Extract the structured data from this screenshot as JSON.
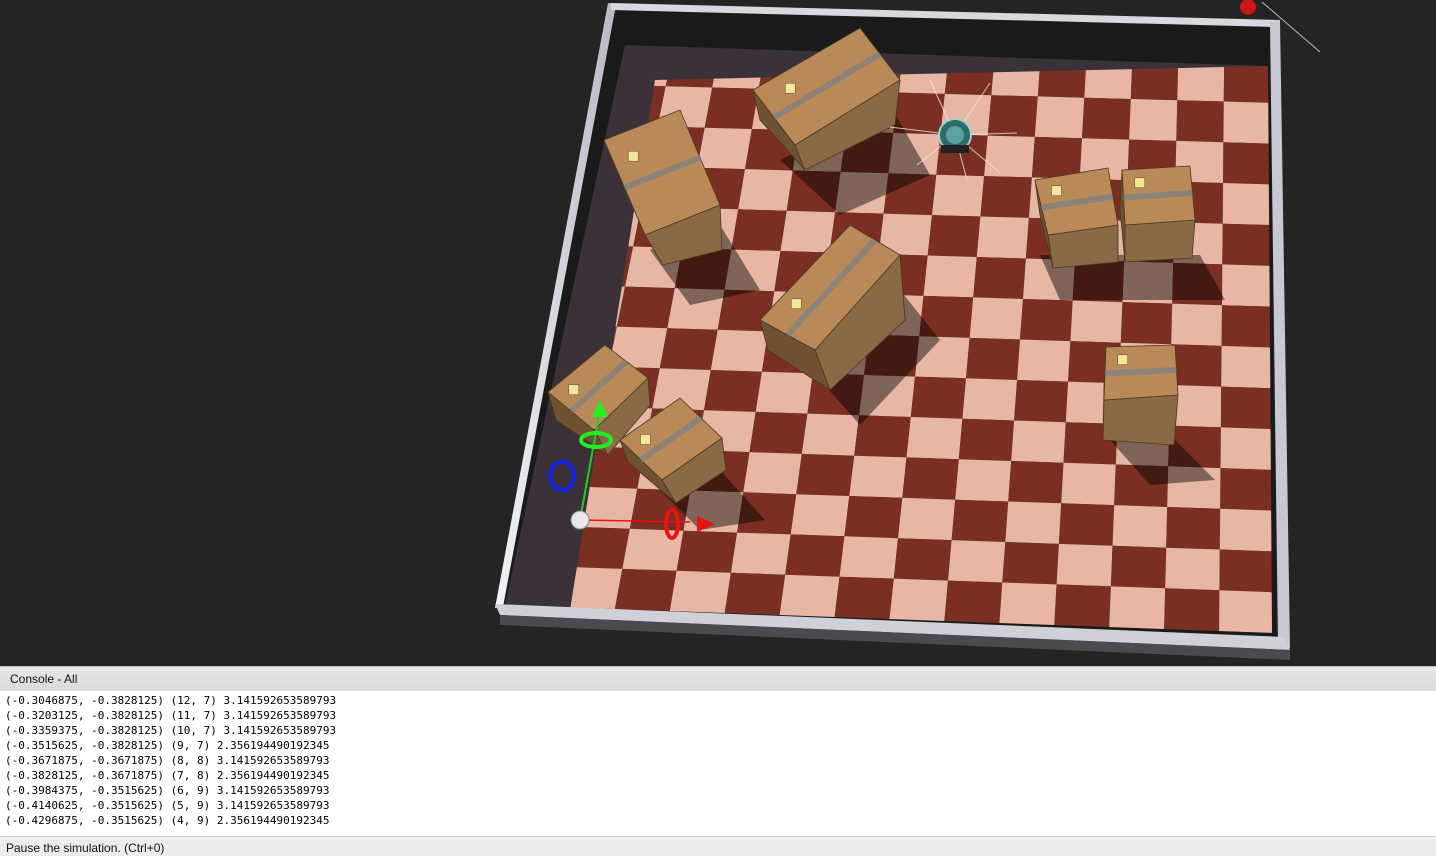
{
  "console": {
    "title": "Console - All",
    "lines": [
      "(-0.3046875, -0.3828125) (12, 7) 3.141592653589793",
      "(-0.3203125, -0.3828125) (11, 7) 3.141592653589793",
      "(-0.3359375, -0.3828125) (10, 7) 3.141592653589793",
      "(-0.3515625, -0.3828125) (9, 7) 2.356194490192345",
      "(-0.3671875, -0.3671875) (8, 8) 3.141592653589793",
      "(-0.3828125, -0.3671875) (7, 8) 2.356194490192345",
      "(-0.3984375, -0.3515625) (6, 9) 3.141592653589793",
      "(-0.4140625, -0.3515625) (5, 9) 3.141592653589793",
      "(-0.4296875, -0.3515625) (4, 9) 2.356194490192345"
    ]
  },
  "status": {
    "text": "Pause the simulation. (Ctrl+0)"
  },
  "scene": {
    "background_color": "#242424",
    "floor_dark_color": "#7a2f22",
    "floor_light_color": "#e8b6a4",
    "wall_color": "#dcdce4",
    "box_color": "#b98a57",
    "axis_x_color": "#ee1111",
    "axis_y_color": "#11cc11",
    "axis_z_color": "#1122ee",
    "checker_cells": 14,
    "objects": [
      "robot",
      "cardboard-box",
      "pose-gizmo"
    ]
  }
}
